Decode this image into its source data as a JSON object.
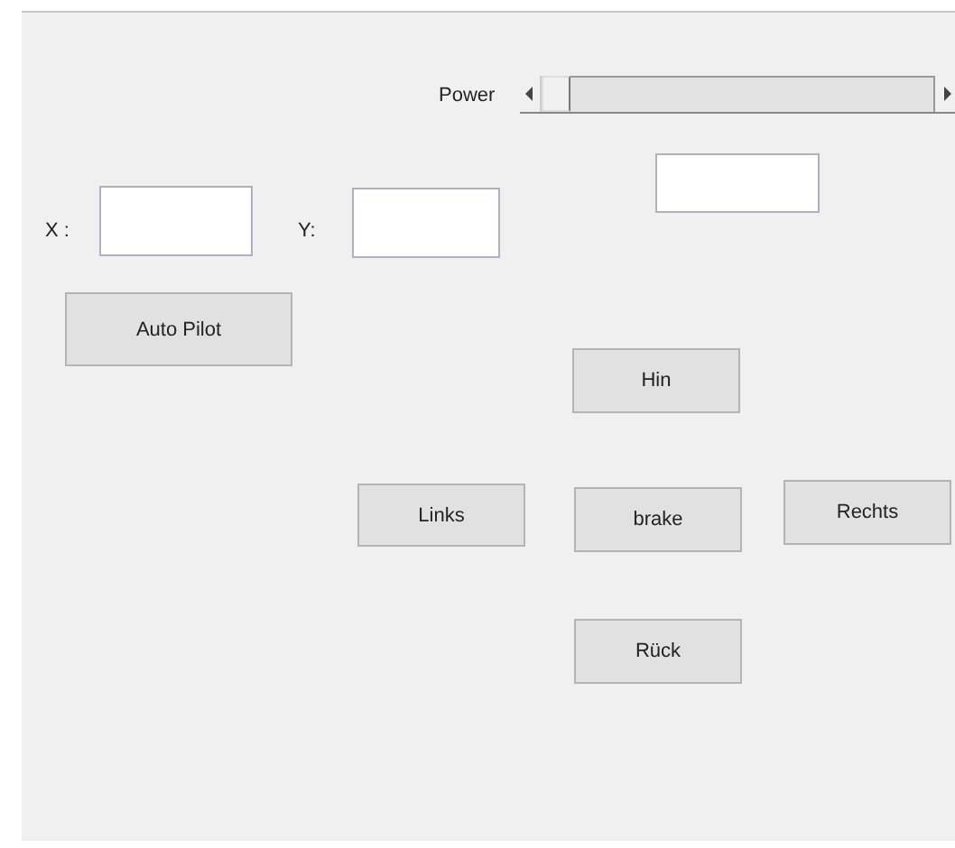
{
  "power": {
    "label": "Power",
    "level": 0
  },
  "display": {
    "kind": "edit"
  },
  "fields": [
    {
      "label": "X :"
    },
    {
      "label": "Y:"
    }
  ],
  "buttons": [
    {
      "label": "Auto Pilot"
    },
    {
      "label": "Hin"
    },
    {
      "label": "Links"
    },
    {
      "label": "brake"
    },
    {
      "label": "Rechts"
    },
    {
      "label": "Rück"
    }
  ]
}
